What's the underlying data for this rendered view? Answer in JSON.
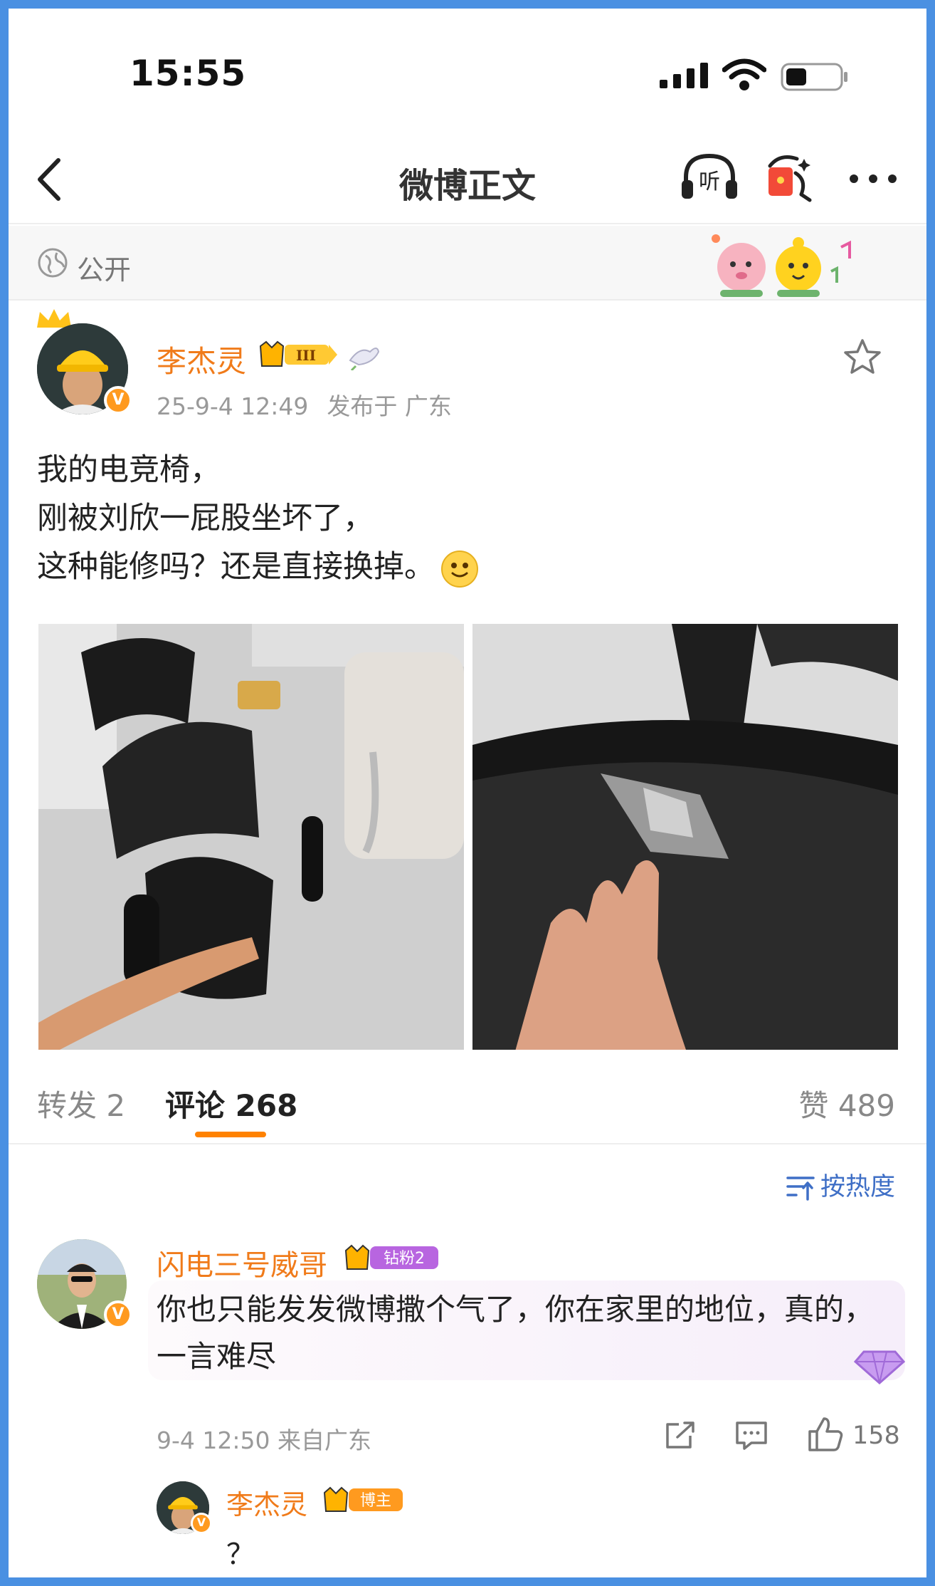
{
  "status_bar": {
    "time": "15:55"
  },
  "nav": {
    "title": "微博正文"
  },
  "visibility": {
    "label": "公开"
  },
  "post": {
    "author": "李杰灵",
    "verified_mark": "V",
    "level_badge": "III",
    "time": "25-9-4 12:49",
    "location": "发布于 广东",
    "lines": [
      "我的电竞椅，",
      "刚被刘欣一屁股坐坏了，",
      "这种能修吗？还是直接换掉。"
    ]
  },
  "tabs": {
    "repost_label": "转发",
    "repost_count": "2",
    "comments_label": "评论",
    "comments_count": "268",
    "likes_label": "赞",
    "likes_count": "489"
  },
  "sort": {
    "label": "按热度"
  },
  "comments": [
    {
      "author": "闪电三号威哥",
      "badge": "钻粉2",
      "text": "你也只能发发微博撒个气了，你在家里的地位，真的，一言难尽",
      "time": "9-4 12:50",
      "location": "来自广东",
      "likes": "158",
      "reply": {
        "author": "李杰灵",
        "badge": "博主",
        "text": "？"
      }
    }
  ],
  "colors": {
    "accent": "#ff8200",
    "username": "#f07b1a",
    "link_blue": "#3f6fc6",
    "frame": "#4a90e2"
  }
}
